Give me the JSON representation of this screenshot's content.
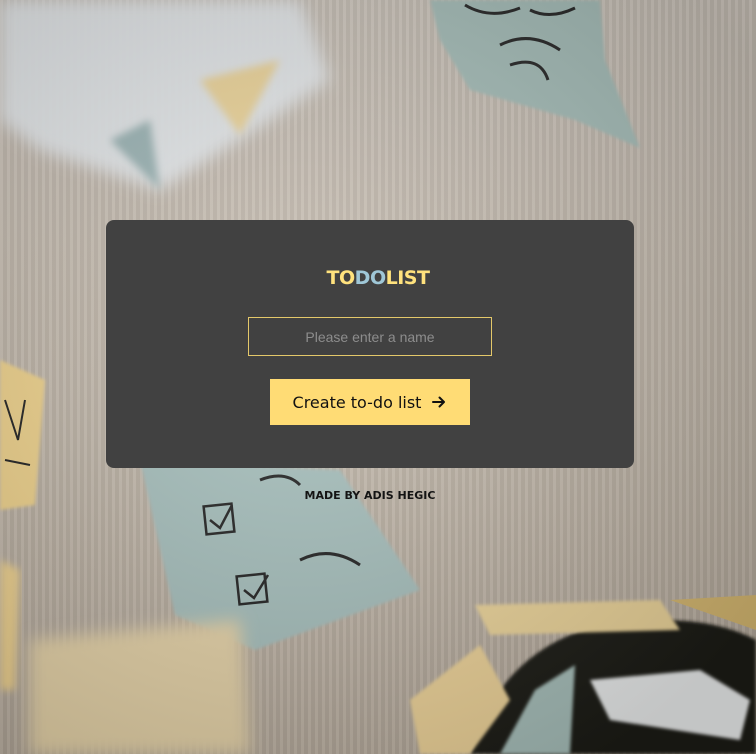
{
  "app": {
    "title_parts": [
      "TO",
      "DO",
      "LIST"
    ]
  },
  "form": {
    "name_placeholder": "Please enter a name",
    "name_value": "",
    "create_label": "Create to-do list",
    "create_icon": "arrow-right-icon"
  },
  "footer": {
    "credit": "MADE BY ADIS HEGIC"
  },
  "colors": {
    "card": "#414141",
    "accent_yellow": "#ffe27d",
    "accent_blue": "#9fc7d7",
    "button": "#ffdc75"
  },
  "background": {
    "image": "sticky-notes-wall-photo"
  }
}
